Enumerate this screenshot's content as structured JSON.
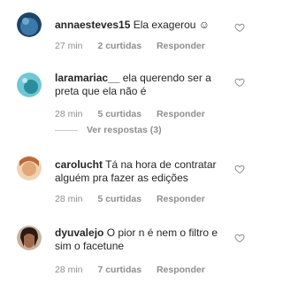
{
  "comments": [
    {
      "username": "annaesteves15",
      "text": "Ela exagerou ☺",
      "time": "27 min",
      "likes": "2 curtidas",
      "reply": "Responder",
      "avatar_color": "#2f5f8a"
    },
    {
      "username": "laramariac__",
      "text": "ela querendo ser a preta que ela não é",
      "time": "28 min",
      "likes": "5 curtidas",
      "reply": "Responder",
      "avatar_color": "#3aa7b8"
    },
    {
      "username": "carolucht",
      "text": "Tá na hora de contratar alguém pra fazer as edições",
      "time": "28 min",
      "likes": "5 curtidas",
      "reply": "Responder",
      "avatar_color": "#d98b5a"
    },
    {
      "username": "dyuvalejo",
      "text": "O pior n é nem o filtro e sim o facetune",
      "time": "28 min",
      "likes": "7 curtidas",
      "reply": "Responder",
      "avatar_color": "#5a3a2e"
    }
  ],
  "view_replies": "Ver respostas (3)",
  "colors": {
    "text": "#262626",
    "meta": "#8e8e8e",
    "heart": "#8e8e8e"
  }
}
